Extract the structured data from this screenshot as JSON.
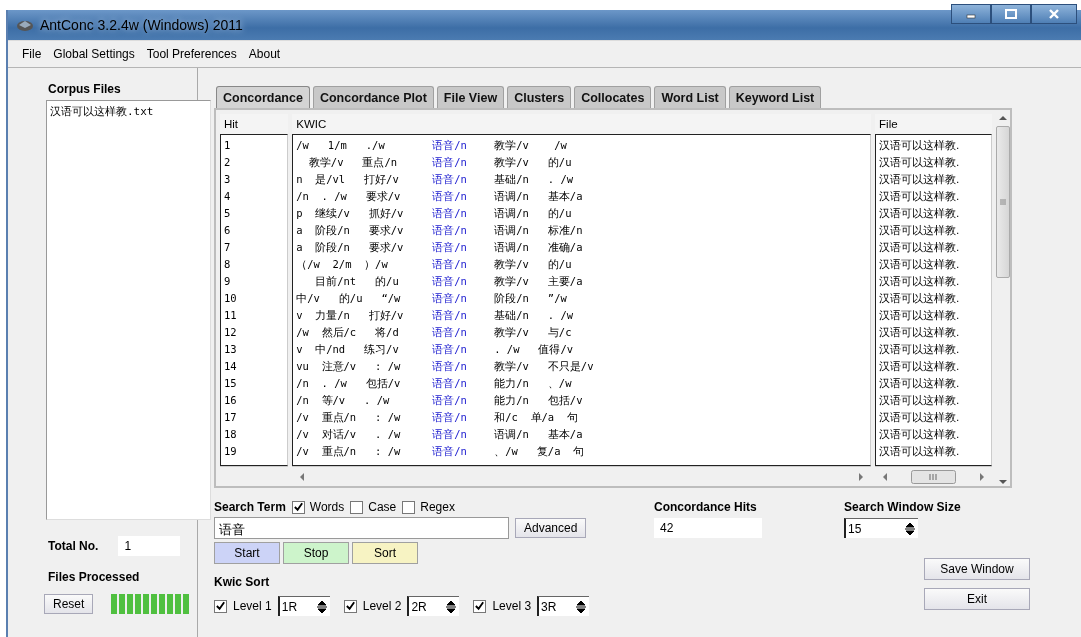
{
  "window": {
    "title": "AntConc 3.2.4w (Windows) 2011"
  },
  "menu": [
    "File",
    "Global Settings",
    "Tool Preferences",
    "About"
  ],
  "corpus": {
    "heading": "Corpus Files",
    "files": [
      "汉语可以这样教.txt"
    ],
    "total_label": "Total No.",
    "total": "1",
    "processed_label": "Files Processed",
    "reset": "Reset",
    "progress": {
      "level": 1
    }
  },
  "tabs": [
    {
      "label": "Concordance",
      "selected": true
    },
    {
      "label": "Concordance Plot",
      "selected": false
    },
    {
      "label": "File View",
      "selected": false
    },
    {
      "label": "Clusters",
      "selected": false
    },
    {
      "label": "Collocates",
      "selected": false
    },
    {
      "label": "Word List",
      "selected": false
    },
    {
      "label": "Keyword List",
      "selected": false
    }
  ],
  "table": {
    "columns": [
      "Hit",
      "KWIC",
      "File"
    ],
    "rows": [
      {
        "hit": "1",
        "left": "/w   1/m   ./w",
        "keyword": "语音/n",
        "right": "教学/v    /w",
        "file": "汉语可以这样教."
      },
      {
        "hit": "2",
        "left": "  教学/v   重点/n",
        "keyword": "语音/n",
        "right": "教学/v   的/u",
        "file": "汉语可以这样教."
      },
      {
        "hit": "3",
        "left": "n  是/vl   打好/v",
        "keyword": "语音/n",
        "right": "基础/n   . /w",
        "file": "汉语可以这样教."
      },
      {
        "hit": "4",
        "left": "/n  . /w   要求/v",
        "keyword": "语音/n",
        "right": "语调/n   基本/a",
        "file": "汉语可以这样教."
      },
      {
        "hit": "5",
        "left": "p  继续/v   抓好/v",
        "keyword": "语音/n",
        "right": "语调/n   的/u",
        "file": "汉语可以这样教."
      },
      {
        "hit": "6",
        "left": "a  阶段/n   要求/v",
        "keyword": "语音/n",
        "right": "语调/n   标准/n",
        "file": "汉语可以这样教."
      },
      {
        "hit": "7",
        "left": "a  阶段/n   要求/v",
        "keyword": "语音/n",
        "right": "语调/n   准确/a",
        "file": "汉语可以这样教."
      },
      {
        "hit": "8",
        "left": "（/w  2/m  ）/w",
        "keyword": "语音/n",
        "right": "教学/v   的/u",
        "file": "汉语可以这样教."
      },
      {
        "hit": "9",
        "left": "   目前/nt   的/u",
        "keyword": "语音/n",
        "right": "教学/v   主要/a",
        "file": "汉语可以这样教."
      },
      {
        "hit": "10",
        "left": "中/v   的/u   “/w",
        "keyword": "语音/n",
        "right": "阶段/n   ”/w",
        "file": "汉语可以这样教."
      },
      {
        "hit": "11",
        "left": "v  力量/n   打好/v",
        "keyword": "语音/n",
        "right": "基础/n   . /w",
        "file": "汉语可以这样教."
      },
      {
        "hit": "12",
        "left": "/w  然后/c   将/d",
        "keyword": "语音/n",
        "right": "教学/v   与/c",
        "file": "汉语可以这样教."
      },
      {
        "hit": "13",
        "left": "v  中/nd   练习/v",
        "keyword": "语音/n",
        "right": ". /w   值得/v",
        "file": "汉语可以这样教."
      },
      {
        "hit": "14",
        "left": "vu  注意/v   : /w",
        "keyword": "语音/n",
        "right": "教学/v   不只是/v",
        "file": "汉语可以这样教."
      },
      {
        "hit": "15",
        "left": "/n  . /w   包括/v",
        "keyword": "语音/n",
        "right": "能力/n   、/w",
        "file": "汉语可以这样教."
      },
      {
        "hit": "16",
        "left": "/n  等/v   . /w",
        "keyword": "语音/n",
        "right": "能力/n   包括/v",
        "file": "汉语可以这样教."
      },
      {
        "hit": "17",
        "left": "/v  重点/n   : /w",
        "keyword": "语音/n",
        "right": "和/c  单/a  句",
        "file": "汉语可以这样教."
      },
      {
        "hit": "18",
        "left": "/v  对话/v   . /w",
        "keyword": "语音/n",
        "right": "语调/n   基本/a",
        "file": "汉语可以这样教."
      },
      {
        "hit": "19",
        "left": "/v  重点/n   : /w",
        "keyword": "语音/n",
        "right": "、/w   复/a  句",
        "file": "汉语可以这样教."
      }
    ]
  },
  "search": {
    "label": "Search Term",
    "options": [
      {
        "label": "Words",
        "checked": true
      },
      {
        "label": "Case",
        "checked": false
      },
      {
        "label": "Regex",
        "checked": false
      }
    ],
    "value": "语音",
    "advanced": "Advanced",
    "buttons": [
      {
        "label": "Start",
        "color": "#ccd3f7"
      },
      {
        "label": "Stop",
        "color": "#cdf4cb"
      },
      {
        "label": "Sort",
        "color": "#f7f3c3"
      }
    ]
  },
  "hits": {
    "label": "Concordance Hits",
    "value": "42"
  },
  "window_size": {
    "label": "Search Window Size",
    "value": "15"
  },
  "kwic_sort": {
    "label": "Kwic Sort",
    "levels": [
      {
        "label": "Level 1",
        "checked": true,
        "value": "1R"
      },
      {
        "label": "Level 2",
        "checked": true,
        "value": "2R"
      },
      {
        "label": "Level 3",
        "checked": true,
        "value": "3R"
      }
    ]
  },
  "actions": [
    "Save Window",
    "Exit"
  ]
}
